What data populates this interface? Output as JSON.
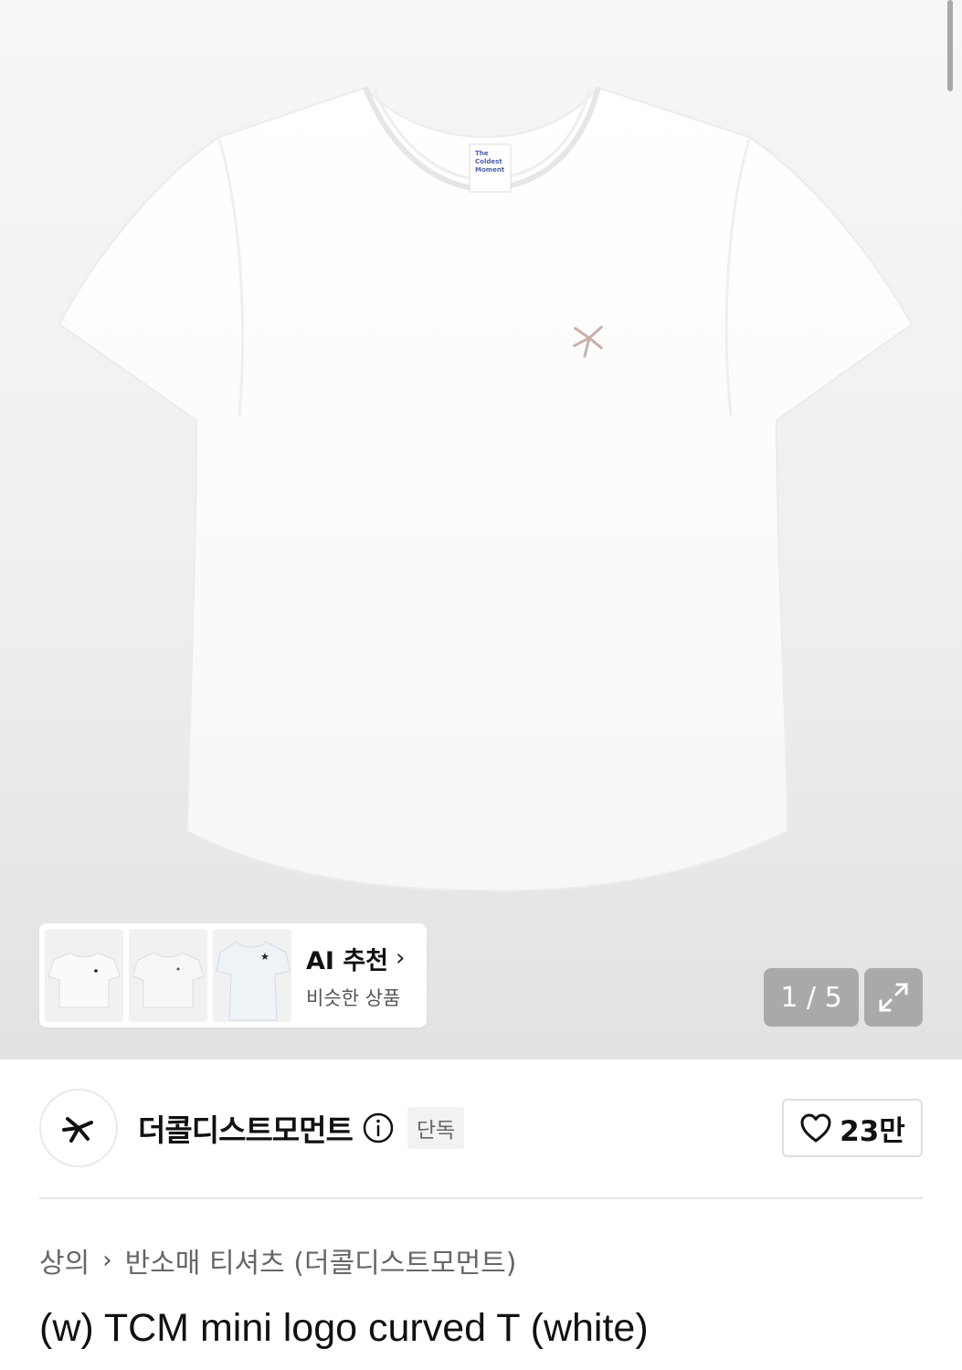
{
  "gallery": {
    "pager_text": "1 / 5",
    "shirt_label_text": [
      "The",
      "Coldest",
      "Moment"
    ]
  },
  "ai_recommend": {
    "title": "AI 추천",
    "subtitle": "비슷한 상품",
    "chevron": "›"
  },
  "brand": {
    "name": "더콜디스트모먼트",
    "badge": "단독",
    "likes": "23만"
  },
  "breadcrumb": {
    "category": "상의",
    "separator": "›",
    "subcategory": "반소매 티셔츠 (더콜디스트모먼트)"
  },
  "product": {
    "title": "(w) TCM mini logo curved T (white)"
  },
  "colors": {
    "pager_bg": "#969696",
    "divider": "#e6e6e6",
    "badge_bg": "#f2f2f2"
  },
  "icons": [
    "expand-icon",
    "info-icon",
    "heart-icon",
    "chevron-right-icon",
    "brand-logo-icon"
  ]
}
